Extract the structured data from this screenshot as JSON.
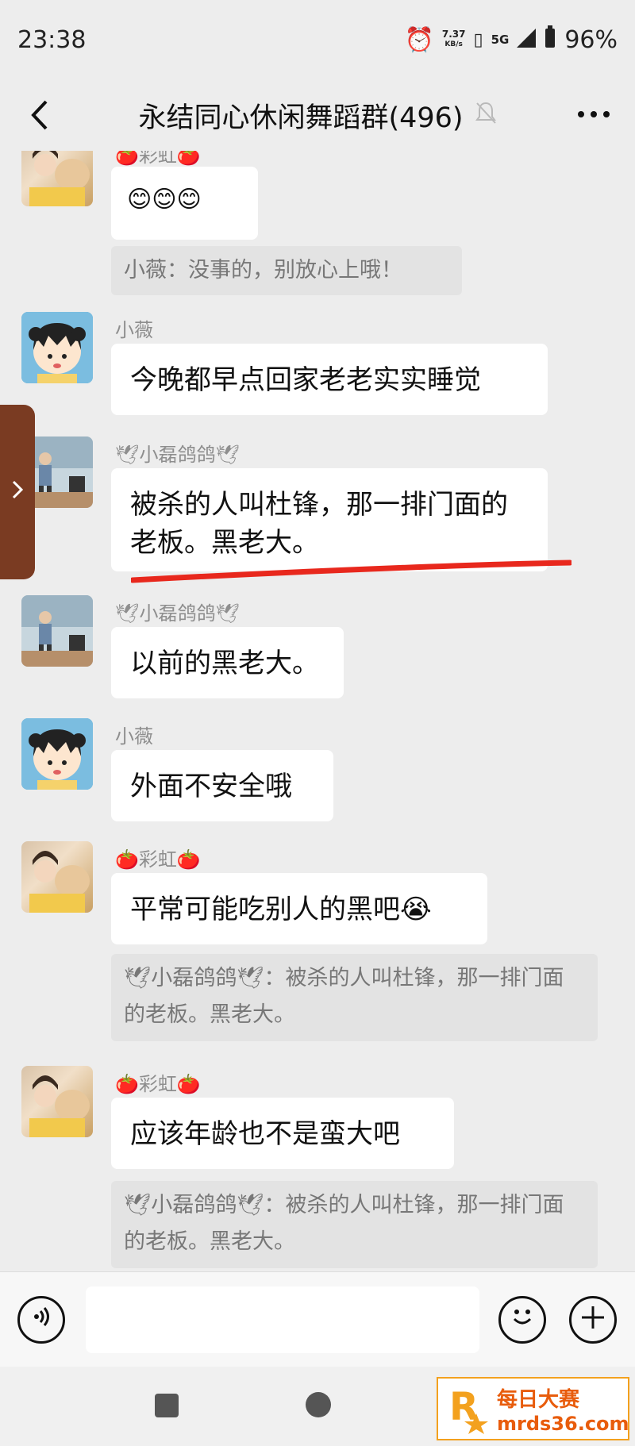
{
  "status_bar": {
    "time": "23:38",
    "speed_value": "7.37",
    "speed_unit": "KB/s",
    "network": "5G",
    "battery": "96%"
  },
  "header": {
    "title": "永结同心休闲舞蹈群(496)"
  },
  "messages": [
    {
      "sender": "🍅彩虹🍅",
      "text": "😊😊😊",
      "quote": "小薇：没事的，别放心上哦！"
    },
    {
      "sender": "小薇",
      "text": "今晚都早点回家老老实实睡觉"
    },
    {
      "sender": "🕊小磊鸽鸽🕊",
      "text": "被杀的人叫杜锋，那一排门面的老板。黑老大。"
    },
    {
      "sender": "🕊小磊鸽鸽🕊",
      "text": "以前的黑老大。"
    },
    {
      "sender": "小薇",
      "text": "外面不安全哦"
    },
    {
      "sender": "🍅彩虹🍅",
      "text": "平常可能吃别人的黑吧😭",
      "quote": "🕊小磊鸽鸽🕊：被杀的人叫杜锋，那一排门面的老板。黑老大。"
    },
    {
      "sender": "🍅彩虹🍅",
      "text": "应该年龄也不是蛮大吧",
      "quote": "🕊小磊鸽鸽🕊：被杀的人叫杜锋，那一排门面的老板。黑老大。"
    }
  ],
  "watermark": {
    "line1": "每日大赛",
    "line2": "mrds36.com"
  },
  "colors": {
    "background": "#ededed",
    "bubble": "#ffffff",
    "quote": "#e3e3e3",
    "underline": "#e8281d",
    "watermark": "#e85c0c"
  }
}
